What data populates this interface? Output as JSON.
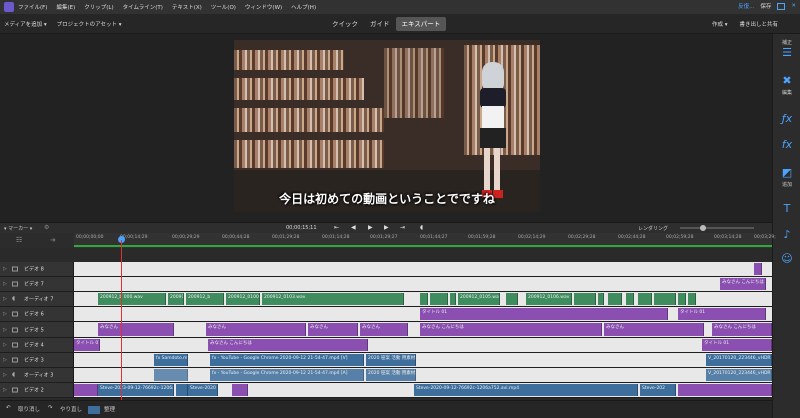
{
  "menubar": {
    "items": [
      "ファイル(F)",
      "編集(E)",
      "クリップ(L)",
      "タイムライン(T)",
      "テキスト(X)",
      "ツール(O)",
      "ウィンドウ(W)",
      "ヘルプ(H)"
    ],
    "right": {
      "label1": "反復...",
      "label2": "保存"
    }
  },
  "toolbar": {
    "add_media": "メディアを追加 ▾",
    "project_assets": "プロジェクトのアセット ▾",
    "modes": [
      "クイック",
      "ガイド",
      "エキスパート"
    ],
    "active_mode": "エキスパート",
    "create": "作成 ▾",
    "export_share": "書き出しと共有"
  },
  "viewer": {
    "subtitle": "今日は初めての動画ということでですね"
  },
  "transport": {
    "timecode": "00;00;15;11",
    "marker": "▾ マーカー ▾",
    "rendering": "レンダリング"
  },
  "ruler": {
    "ticks": [
      "00;00;00;00",
      "00;00;14;29",
      "00;00;29;29",
      "00;00;44;28",
      "00;01;29;28",
      "00;01;14;28",
      "00;01;29;27",
      "00;01;44;27",
      "00;01;59;28",
      "00;02;14;29",
      "00;02;29;28",
      "00;02;44;28",
      "00;02;59;28",
      "00;03;14;28",
      "00;03;29;"
    ]
  },
  "right_panel": {
    "items": [
      {
        "label": "補正",
        "icon": "sliders-icon"
      },
      {
        "label": "編集",
        "icon": "wrench-icon"
      },
      {
        "label": "",
        "icon": "fx-icon"
      },
      {
        "label": "追加",
        "icon": "title-icon"
      },
      {
        "label": "",
        "icon": "music-icon"
      },
      {
        "label": "",
        "icon": "smiley-icon"
      }
    ]
  },
  "tracks": [
    {
      "name": "ビデオ 8",
      "clips": []
    },
    {
      "name": "ビデオ 7",
      "clips": [
        {
          "label": "みなさん こんにちは",
          "color": "purple"
        }
      ]
    },
    {
      "name": "オーディオ 7",
      "clips": [
        {
          "label": "200912_b 000.wav",
          "color": "green"
        },
        {
          "label": "200912_b",
          "color": "green"
        },
        {
          "label": "200912_b",
          "color": "green"
        },
        {
          "label": "200912_0100.w",
          "color": "green"
        },
        {
          "label": "200912_0103.wav",
          "color": "green"
        },
        {
          "label": "200912_0105.wav",
          "color": "green"
        },
        {
          "label": "200912_0106.wav",
          "color": "green"
        }
      ]
    },
    {
      "name": "ビデオ 6",
      "clips": [
        {
          "label": "タイトル 01",
          "color": "purple"
        },
        {
          "label": "タイトル 01",
          "color": "purple"
        }
      ]
    },
    {
      "name": "ビデオ 5",
      "clips": [
        {
          "label": "みなさん",
          "color": "purple"
        },
        {
          "label": "みなさん こんにちは",
          "color": "purple"
        }
      ]
    },
    {
      "name": "ビデオ 4",
      "clips": [
        {
          "label": "タイトル 01",
          "color": "purple"
        },
        {
          "label": "みなさん こんにちは",
          "color": "purple"
        },
        {
          "label": "タイトル 01",
          "color": "purple"
        }
      ]
    },
    {
      "name": "ビデオ 3",
      "clips": [
        {
          "label": "fx Samdoto.mp",
          "color": "blue"
        },
        {
          "label": "fx - YouTube - Google Chrome 2020-09-12 21-54-47.mp4 [V]",
          "color": "blue"
        },
        {
          "label": "2020 笹案 活動 用素材",
          "color": "blue"
        },
        {
          "label": "V_20170120_223446_vHDR",
          "color": "blue"
        }
      ]
    },
    {
      "name": "オーディオ 3",
      "clips": [
        {
          "label": "fx - YouTube - Google Chrome 2020-09-12 21-54-47.mp4 [A]",
          "color": "blue"
        },
        {
          "label": "2020 笹案 活動 用素材",
          "color": "blue"
        },
        {
          "label": "V_20170120_223446_vHDR",
          "color": "blue"
        }
      ]
    },
    {
      "name": "ビデオ 2",
      "clips": [
        {
          "label": "Steve-2023-09-12-76692c-1206a752",
          "color": "blue"
        },
        {
          "label": "Steve-2020",
          "color": "blue"
        },
        {
          "label": "Steve-2020-09-12-76692c-1206a752.avi.mp4",
          "color": "blue"
        },
        {
          "label": "Steve-202",
          "color": "blue"
        }
      ]
    }
  ],
  "bottombar": {
    "undo": "取り消し",
    "redo": "やり直し",
    "organizer": "整理"
  },
  "colors": {
    "accent": "#4aa3ff",
    "green_clip": "#3f8c5f",
    "purple_clip": "#8a4fb0",
    "blue_clip": "#3d6e9c",
    "playhead": "#e03030"
  }
}
